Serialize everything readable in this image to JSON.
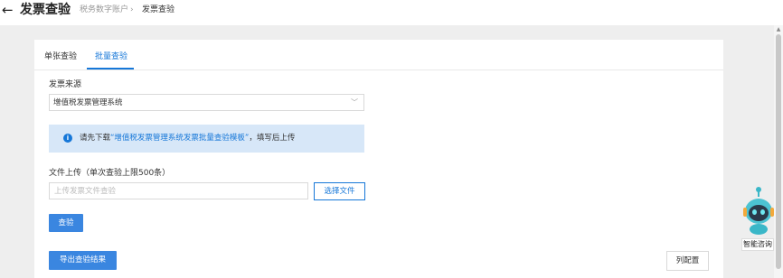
{
  "header": {
    "back_icon": "left-arrow-icon",
    "title": "发票查验",
    "breadcrumb_parent": "税务数字账户",
    "breadcrumb_sep": "›",
    "breadcrumb_current": "发票查验"
  },
  "tabs": [
    {
      "label": "单张查验",
      "active": false
    },
    {
      "label": "批量查验",
      "active": true
    }
  ],
  "form": {
    "source_label": "发票来源",
    "source_value": "增值税发票管理系统",
    "notice_pre": "请先下载",
    "notice_link": "“增值税发票管理系统发票批量查验模板”",
    "notice_post": "，填写后上传",
    "upload_label": "文件上传（单次查验上限500条）",
    "upload_placeholder": "上传发票文件查验",
    "choose_file_label": "选择文件",
    "verify_label": "查验"
  },
  "actions": {
    "export_label": "导出查验结果",
    "column_config_label": "列配置"
  },
  "assistant": {
    "label": "智能咨询",
    "icon": "robot-assistant-icon"
  },
  "colors": {
    "accent": "#1677d8",
    "primary_button": "#3a86e0",
    "notice_bg": "#d7e7f8",
    "page_bg": "#eeeeee"
  }
}
